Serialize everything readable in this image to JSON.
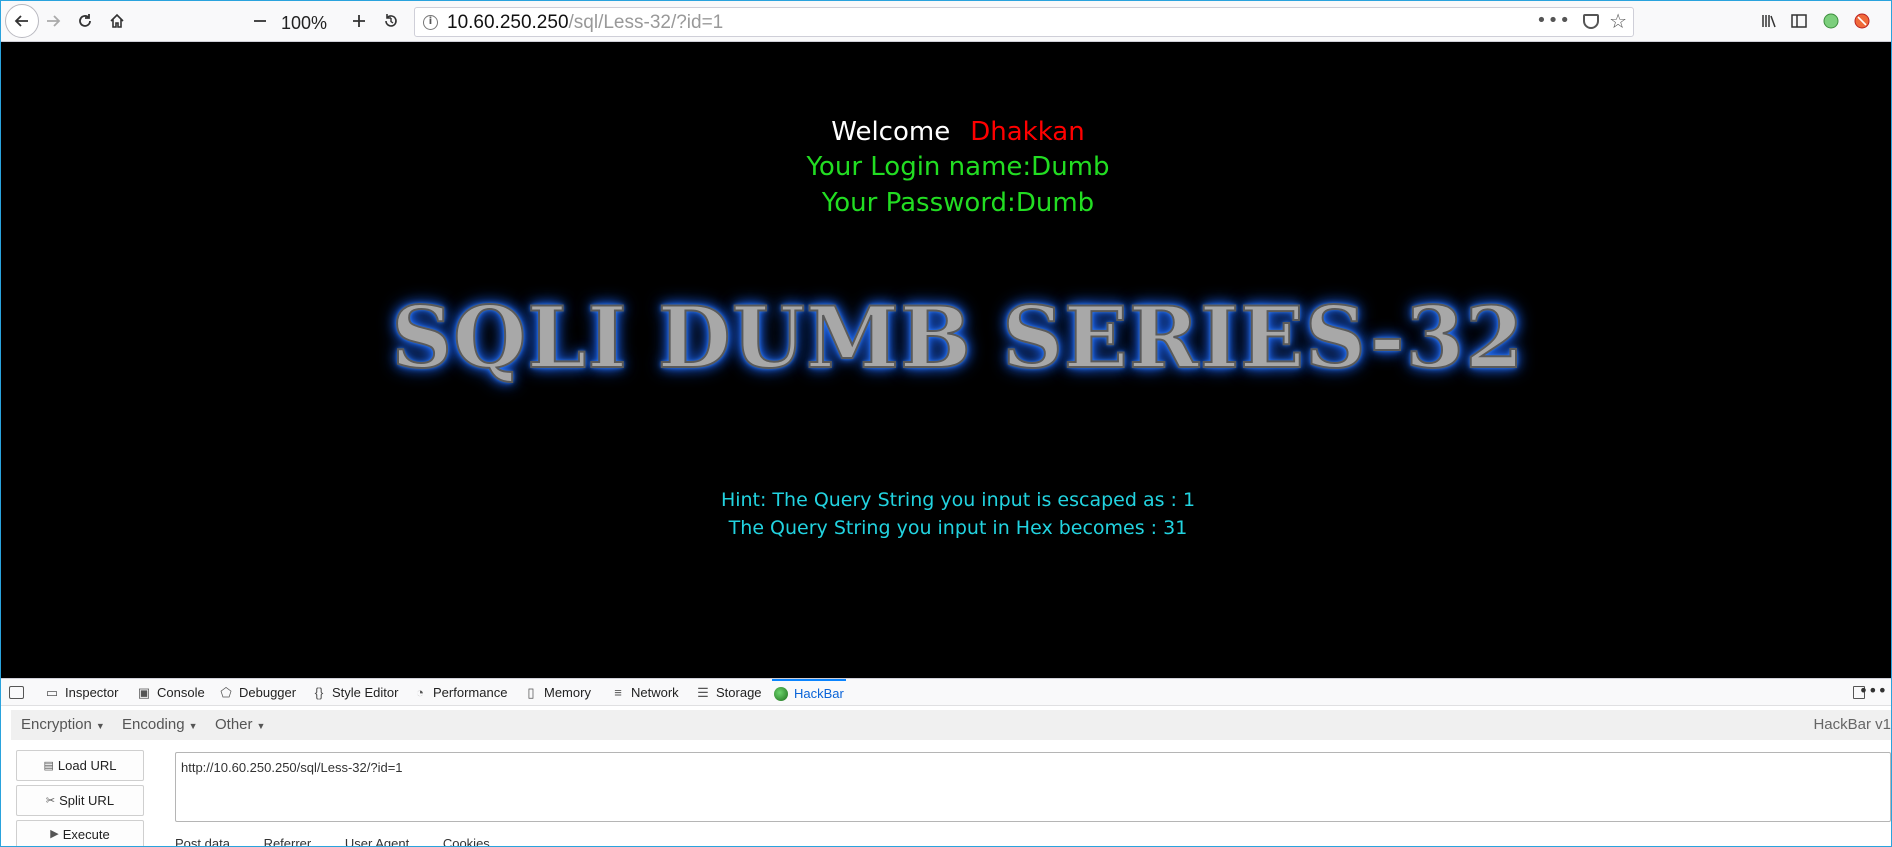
{
  "browser": {
    "zoom_level": "100%",
    "url_host": "10.60.250.250",
    "url_path": "/sql/Less-32/?id=1"
  },
  "page": {
    "welcome_label": "Welcome",
    "welcome_name": "Dhakkan",
    "login_line": "Your Login name:Dumb",
    "password_line": "Your Password:Dumb",
    "series_title": "SQLI DUMB SERIES-32",
    "hint_line": "Hint: The Query String you input is escaped as : 1",
    "hex_line": "The Query String you input in Hex becomes : 31",
    "colors": {
      "welcome_name": "#ff0000",
      "login_text": "#22dd22",
      "hint_text": "#22d3e0",
      "title_glow": "#1b5fe8"
    }
  },
  "devtools": {
    "tabs": [
      "Inspector",
      "Console",
      "Debugger",
      "Style Editor",
      "Performance",
      "Memory",
      "Network",
      "Storage",
      "HackBar"
    ],
    "active_tab": "HackBar"
  },
  "hackbar": {
    "menus": [
      "Encryption",
      "Encoding",
      "Other"
    ],
    "version": "HackBar v1",
    "load_url": "Load URL",
    "split_url": "Split URL",
    "execute": "Execute",
    "url_value": "http://10.60.250.250/sql/Less-32/?id=1",
    "options": [
      "Post data",
      "Referrer",
      "User Agent",
      "Cookies"
    ]
  }
}
